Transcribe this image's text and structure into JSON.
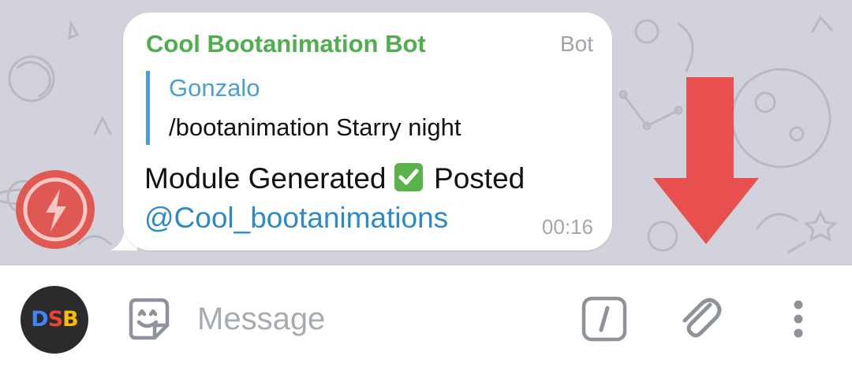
{
  "message": {
    "sender": "Cool Bootanimation Bot",
    "badge": "Bot",
    "reply_author": "Gonzalo",
    "reply_text": "/bootanimation Starry night",
    "text_line1_before": "Module Generated",
    "text_line1_after": " Posted",
    "mention": "@Cool_bootanimations",
    "time": "00:16"
  },
  "input_bar": {
    "avatar_letters": [
      "D",
      "S",
      "B"
    ],
    "placeholder": "Message"
  },
  "icons": {
    "left_avatar": "lightning-bolt-icon",
    "sticker": "sticker-smile-icon",
    "commands": "slash-command-icon",
    "attach": "paperclip-icon",
    "more": "vertical-dots-icon",
    "check": "check-mark-emoji-icon",
    "arrow": "red-down-arrow-icon"
  },
  "colors": {
    "sender": "#4fae4e",
    "reply_accent": "#4a9fd4",
    "mention": "#2e8ac7",
    "arrow": "#e8504f",
    "check": "#5ab34a"
  }
}
